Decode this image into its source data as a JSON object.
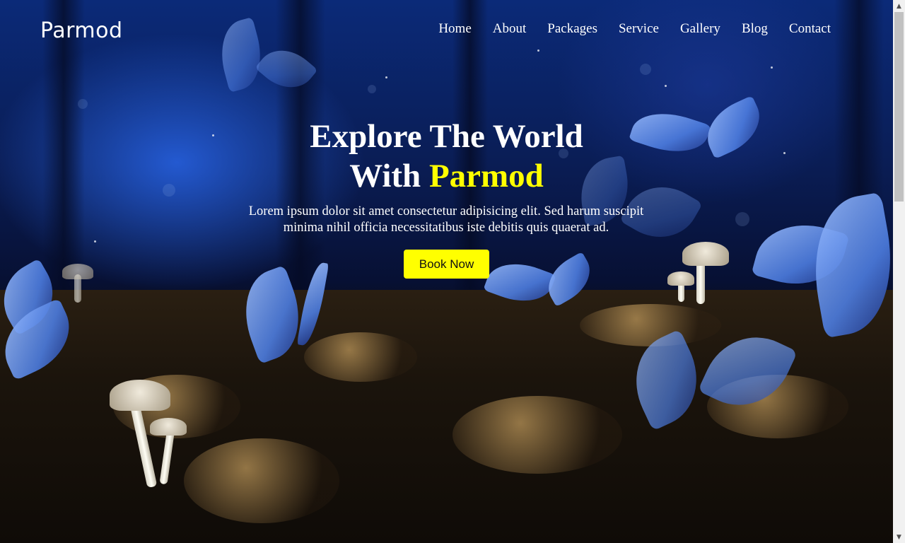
{
  "brand": {
    "logo": "Parmod"
  },
  "nav": {
    "items": [
      "Home",
      "About",
      "Packages",
      "Service",
      "Gallery",
      "Blog",
      "Contact"
    ]
  },
  "hero": {
    "headline_line1": "Explore The World",
    "headline_line2_prefix": "With ",
    "headline_line2_accent": "Parmod",
    "subtitle": "Lorem ipsum dolor sit amet consectetur adipisicing elit. Sed harum suscipit minima nihil officia necessitatibus iste debitis quis quaerat ad.",
    "cta_label": "Book Now"
  },
  "colors": {
    "accent": "#ffff00",
    "text": "#ffffff",
    "button_text": "#111111"
  },
  "scrollbar": {
    "up_icon": "triangle-up-icon",
    "down_icon": "triangle-down-icon"
  }
}
